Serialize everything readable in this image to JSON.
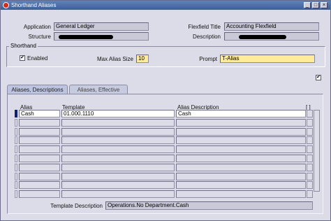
{
  "window": {
    "title": "Shorthand Aliases",
    "min_glyph": "_",
    "max_glyph": "□",
    "close_glyph": "×"
  },
  "header": {
    "application_label": "Application",
    "application_value": "General Ledger",
    "structure_label": "Structure",
    "flexfield_title_label": "Flexfield Title",
    "flexfield_title_value": "Accounting Flexfield",
    "description_label": "Description"
  },
  "shorthand": {
    "title": "Shorthand",
    "enabled_label": "Enabled",
    "enabled_checked": true,
    "max_alias_size_label": "Max Alias Size",
    "max_alias_size_value": "10",
    "prompt_label": "Prompt",
    "prompt_value": "T-Alias"
  },
  "extra_checkbox_checked": true,
  "tabs": [
    {
      "label": "Aliases, Descriptions",
      "active": true
    },
    {
      "label": "Aliases, Effective",
      "active": false
    }
  ],
  "table": {
    "columns": [
      "Alias",
      "Template",
      "Alias Description"
    ],
    "corner_label": "[ ]",
    "rows": [
      {
        "alias": "Cash",
        "template": "01.000.1110",
        "description": "Cash"
      },
      {
        "alias": "",
        "template": "",
        "description": ""
      },
      {
        "alias": "",
        "template": "",
        "description": ""
      },
      {
        "alias": "",
        "template": "",
        "description": ""
      },
      {
        "alias": "",
        "template": "",
        "description": ""
      },
      {
        "alias": "",
        "template": "",
        "description": ""
      },
      {
        "alias": "",
        "template": "",
        "description": ""
      },
      {
        "alias": "",
        "template": "",
        "description": ""
      },
      {
        "alias": "",
        "template": "",
        "description": ""
      },
      {
        "alias": "",
        "template": "",
        "description": ""
      }
    ]
  },
  "template_description": {
    "label": "Template Description",
    "value": "Operations.No Department.Cash"
  },
  "colors": {
    "titlebar": "#4a6ca5",
    "window_bg": "#dcdce8",
    "required_field": "#ffeb9a",
    "current_row_indicator": "#102070"
  }
}
